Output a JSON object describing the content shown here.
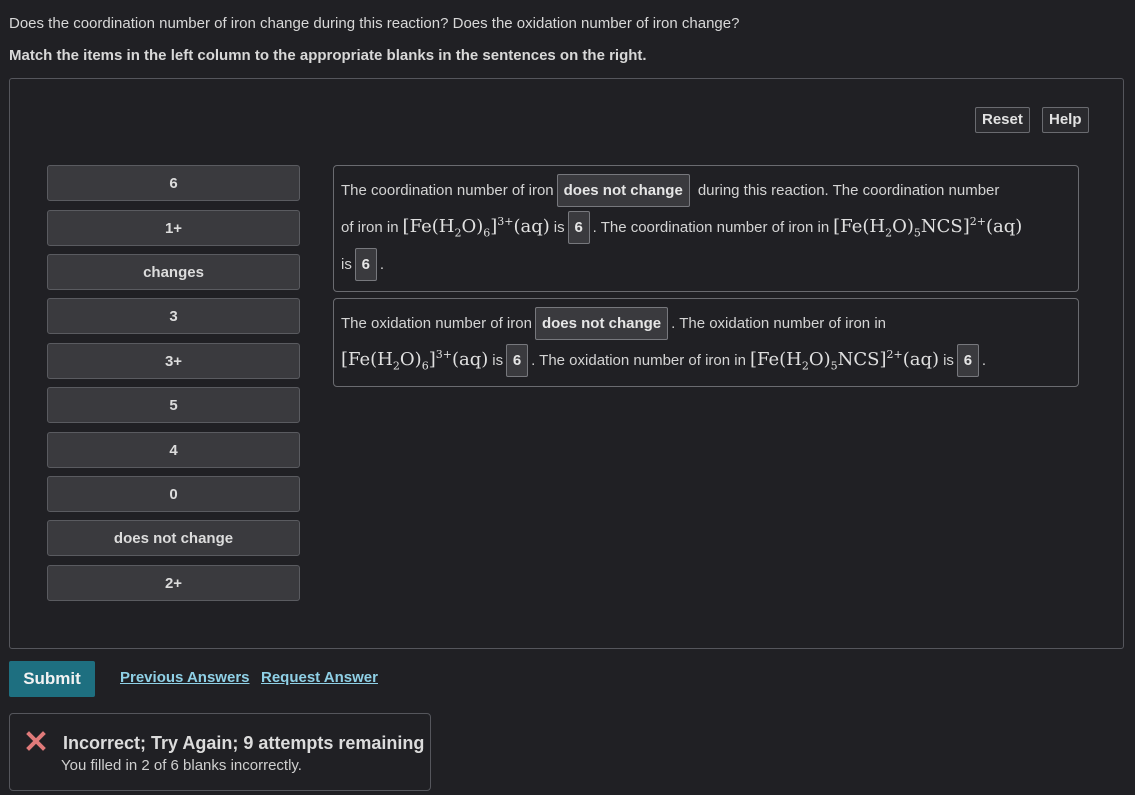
{
  "question": "Does the coordination number of iron change during this reaction? Does the oxidation number of iron change?",
  "instruction": "Match the items in the left column to the appropriate blanks in the sentences on the right.",
  "buttons": {
    "reset": "Reset",
    "help": "Help",
    "submit": "Submit"
  },
  "items": [
    "6",
    "1+",
    "changes",
    "3",
    "3+",
    "5",
    "4",
    "0",
    "does not change",
    "2+"
  ],
  "sentence1": {
    "t1": "The coordination number of iron",
    "b1": "does not change",
    "t2": "during this reaction. The coordination number",
    "t3": "of iron in",
    "t4": "is",
    "b2": "6",
    "t5": ". The coordination number of iron in",
    "t6": "is",
    "b3": "6",
    "t7": "."
  },
  "sentence2": {
    "t1": "The oxidation number of iron",
    "b1": "does not change",
    "t2": ". The oxidation number of iron in",
    "t3": "is",
    "b2": "6",
    "t4": ". The oxidation number of iron in",
    "t5": "is",
    "b3": "6",
    "t6": "."
  },
  "formulas": {
    "hexaaqua": {
      "base": "[Fe(H",
      "sub1": "2",
      "mid": "O)",
      "sub2": "6",
      "close": "]",
      "sup": "3+",
      "state": "(aq)"
    },
    "thiocyanato": {
      "base": "[Fe(H",
      "sub1": "2",
      "mid": "O)",
      "sub2": "5",
      "close": "NCS]",
      "sup": "2+",
      "state": "(aq)"
    }
  },
  "links": {
    "previous": "Previous Answers",
    "request": "Request Answer"
  },
  "feedback": {
    "title": "Incorrect; Try Again; 9 attempts remaining",
    "detail": "You filled in 2 of 6 blanks incorrectly.",
    "icon": "close-icon",
    "icon_color": "#e07a7a"
  },
  "colors": {
    "submit": "#1e6f80",
    "link": "#8fd0e6",
    "background": "#202024"
  }
}
